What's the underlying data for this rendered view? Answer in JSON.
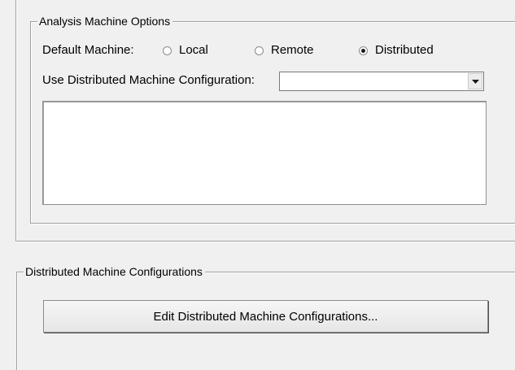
{
  "analysis_options": {
    "title": "Analysis Machine Options",
    "default_machine_label": "Default Machine:",
    "radio_local": "Local",
    "radio_remote": "Remote",
    "radio_distributed": "Distributed",
    "selected": "Distributed",
    "use_config_label": "Use Distributed Machine Configuration:",
    "config_value": "",
    "config_list_items": []
  },
  "distributed_configs": {
    "title": "Distributed Machine Configurations",
    "edit_button_label": "Edit Distributed Machine Configurations..."
  },
  "icons": {
    "dropdown": "chevron-down-icon"
  }
}
